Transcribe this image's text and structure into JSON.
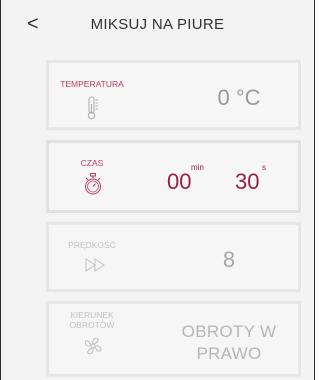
{
  "header": {
    "back_icon": "chevron-left-icon",
    "back_glyph": "<",
    "title": "MIKSUJ NA PIURE"
  },
  "temperature": {
    "label": "TEMPERATURA",
    "icon": "thermometer-icon",
    "value": "0 °C"
  },
  "time": {
    "label": "CZAS",
    "icon": "stopwatch-icon",
    "minutes": "00",
    "minutes_unit": "min",
    "seconds": "30",
    "seconds_unit": "s"
  },
  "speed": {
    "label": "PRĘDKOŚĆ",
    "icon": "fast-forward-icon",
    "value": "8"
  },
  "direction": {
    "label_line1": "KIERUNEK",
    "label_line2": "OBROTÓW",
    "icon": "rotation-fan-icon",
    "value_line1": "OBROTY W",
    "value_line2": "PRAWO"
  },
  "colors": {
    "accent": "#9a1f45",
    "label_active": "#c33a5a",
    "label_inactive": "#c2c2c2",
    "value_gray": "#9a9a9a"
  }
}
